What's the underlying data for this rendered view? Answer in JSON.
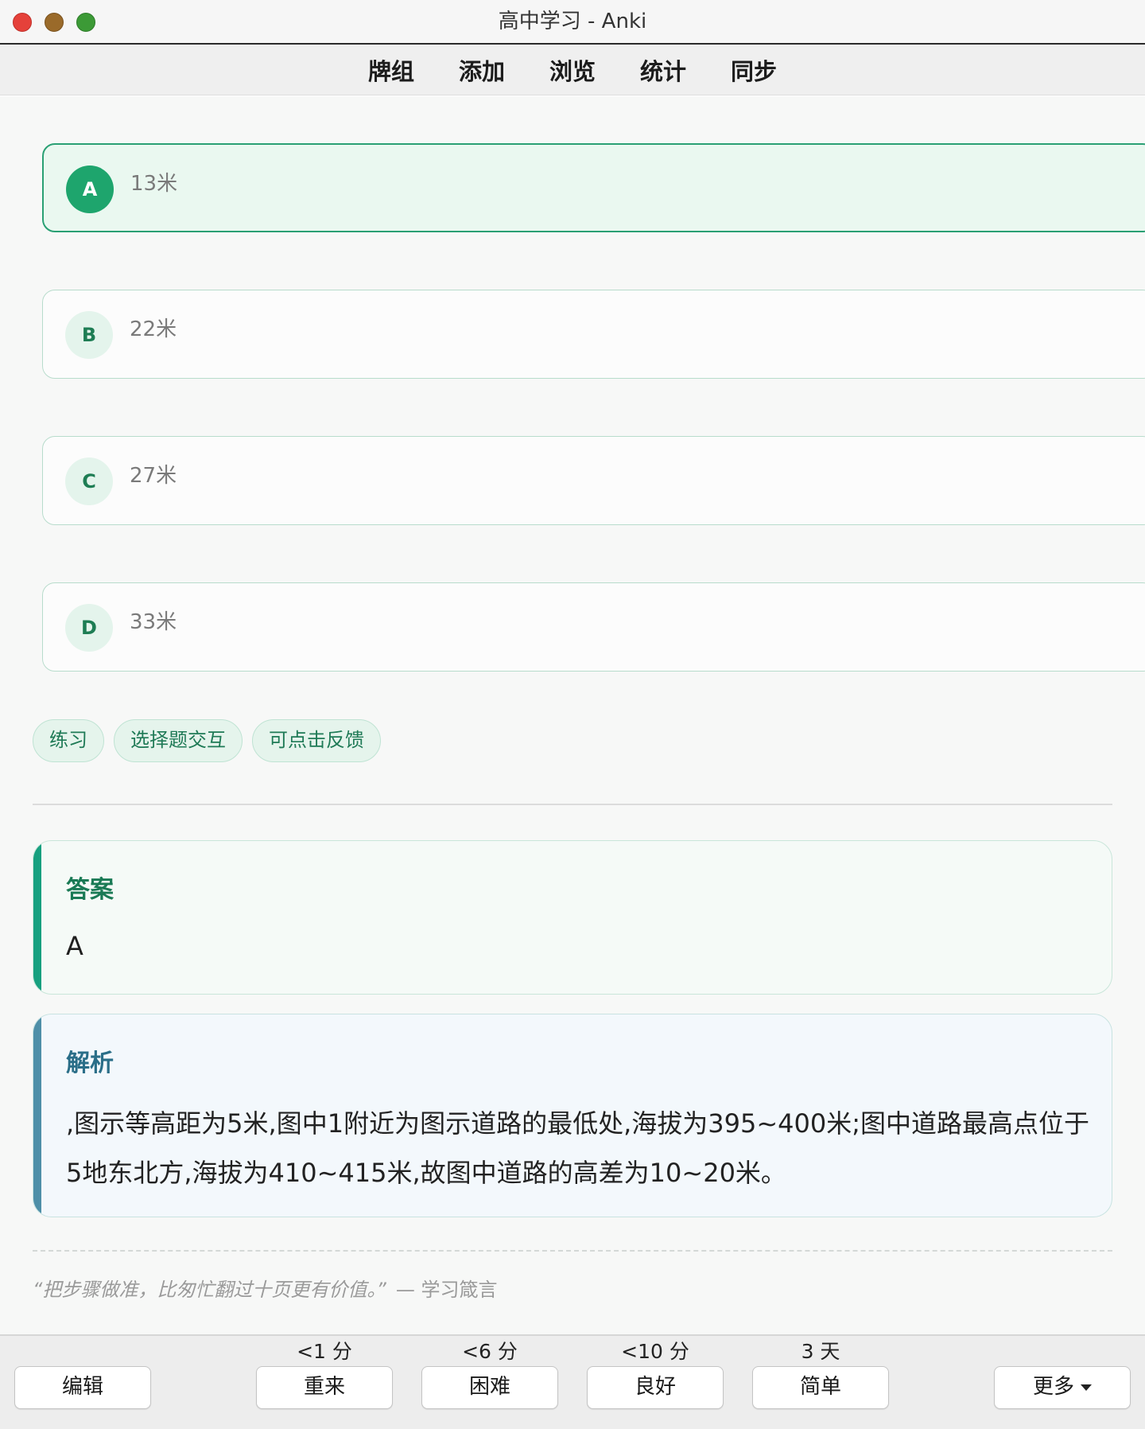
{
  "window": {
    "title": "高中学习 - Anki"
  },
  "toolbar": {
    "items": [
      "牌组",
      "添加",
      "浏览",
      "统计",
      "同步"
    ]
  },
  "options": [
    {
      "letter": "A",
      "text": "13米",
      "selected": true
    },
    {
      "letter": "B",
      "text": "22米",
      "selected": false
    },
    {
      "letter": "C",
      "text": "27米",
      "selected": false
    },
    {
      "letter": "D",
      "text": "33米",
      "selected": false
    }
  ],
  "tags": [
    "练习",
    "选择题交互",
    "可点击反馈"
  ],
  "answer": {
    "title": "答案",
    "value": "A"
  },
  "analysis": {
    "title": "解析",
    "text": ",图示等高距为5米,图中1附近为图示道路的最低处,海拔为395~400米;图中道路最高点位于5地东北方,海拔为410~415米,故图中道路的高差为10~20米。"
  },
  "quote": {
    "text": "“把步骤做准，比匆忙翻过十页更有价值。”",
    "source": "— 学习箴言"
  },
  "bottom_bar": {
    "edit_label": "编辑",
    "more_label": "更多",
    "answers": [
      {
        "label": "重来",
        "interval": "<1 分"
      },
      {
        "label": "困难",
        "interval": "<6 分"
      },
      {
        "label": "良好",
        "interval": "<10 分"
      },
      {
        "label": "简单",
        "interval": "3 天"
      }
    ]
  },
  "colors": {
    "accent_green": "#1ea56d",
    "answer_bar": "#17a07f",
    "analysis_bar": "#4e8fa8",
    "traffic_red": "#e5413a",
    "traffic_yellow": "#9a6a2a",
    "traffic_green": "#3c9a36"
  }
}
